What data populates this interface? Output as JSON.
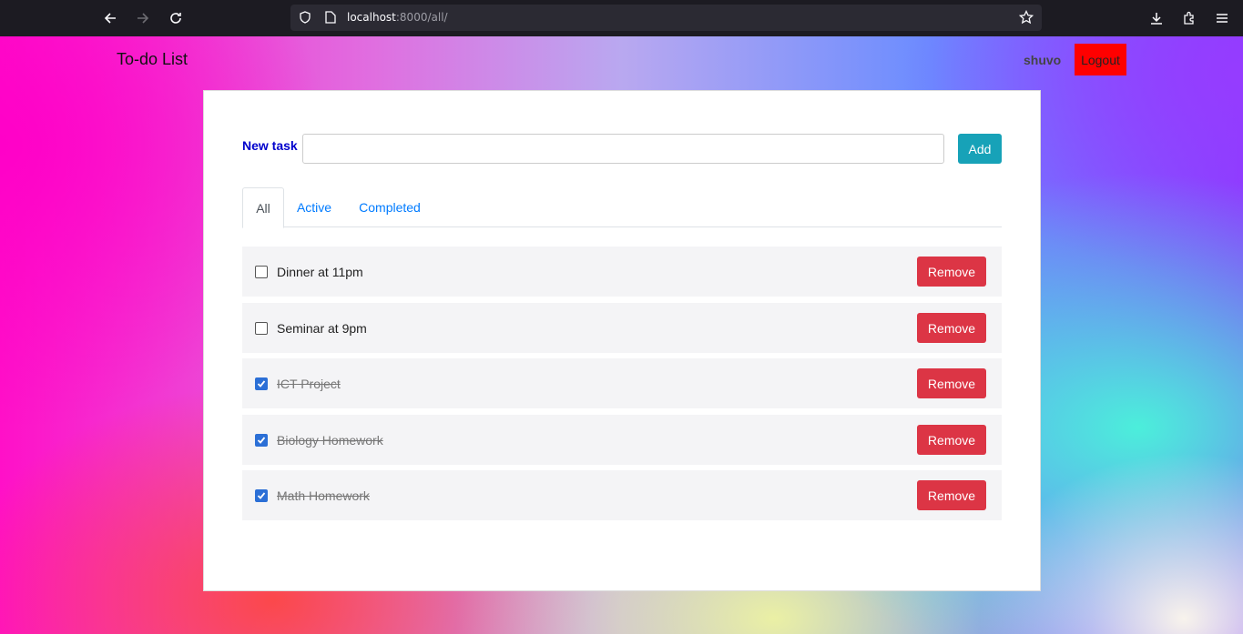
{
  "browser": {
    "url_host": "localhost",
    "url_rest": ":8000/all/"
  },
  "navbar": {
    "brand": "To-do List",
    "username": "shuvo",
    "logout_label": "Logout"
  },
  "form": {
    "label": "New task",
    "input_value": "",
    "add_label": "Add"
  },
  "tabs": [
    {
      "label": "All",
      "active": true
    },
    {
      "label": "Active",
      "active": false
    },
    {
      "label": "Completed",
      "active": false
    }
  ],
  "todos": [
    {
      "text": "Dinner at 11pm",
      "completed": false,
      "remove_label": "Remove"
    },
    {
      "text": "Seminar at 9pm",
      "completed": false,
      "remove_label": "Remove"
    },
    {
      "text": "ICT Project",
      "completed": true,
      "remove_label": "Remove"
    },
    {
      "text": "Biology Homework",
      "completed": true,
      "remove_label": "Remove"
    },
    {
      "text": "Math Homework",
      "completed": true,
      "remove_label": "Remove"
    }
  ],
  "colors": {
    "add_button": "#17a2b8",
    "remove_button": "#dc3545",
    "logout_button": "#ff0000",
    "tab_link": "#007bff",
    "label": "#0000cc"
  }
}
